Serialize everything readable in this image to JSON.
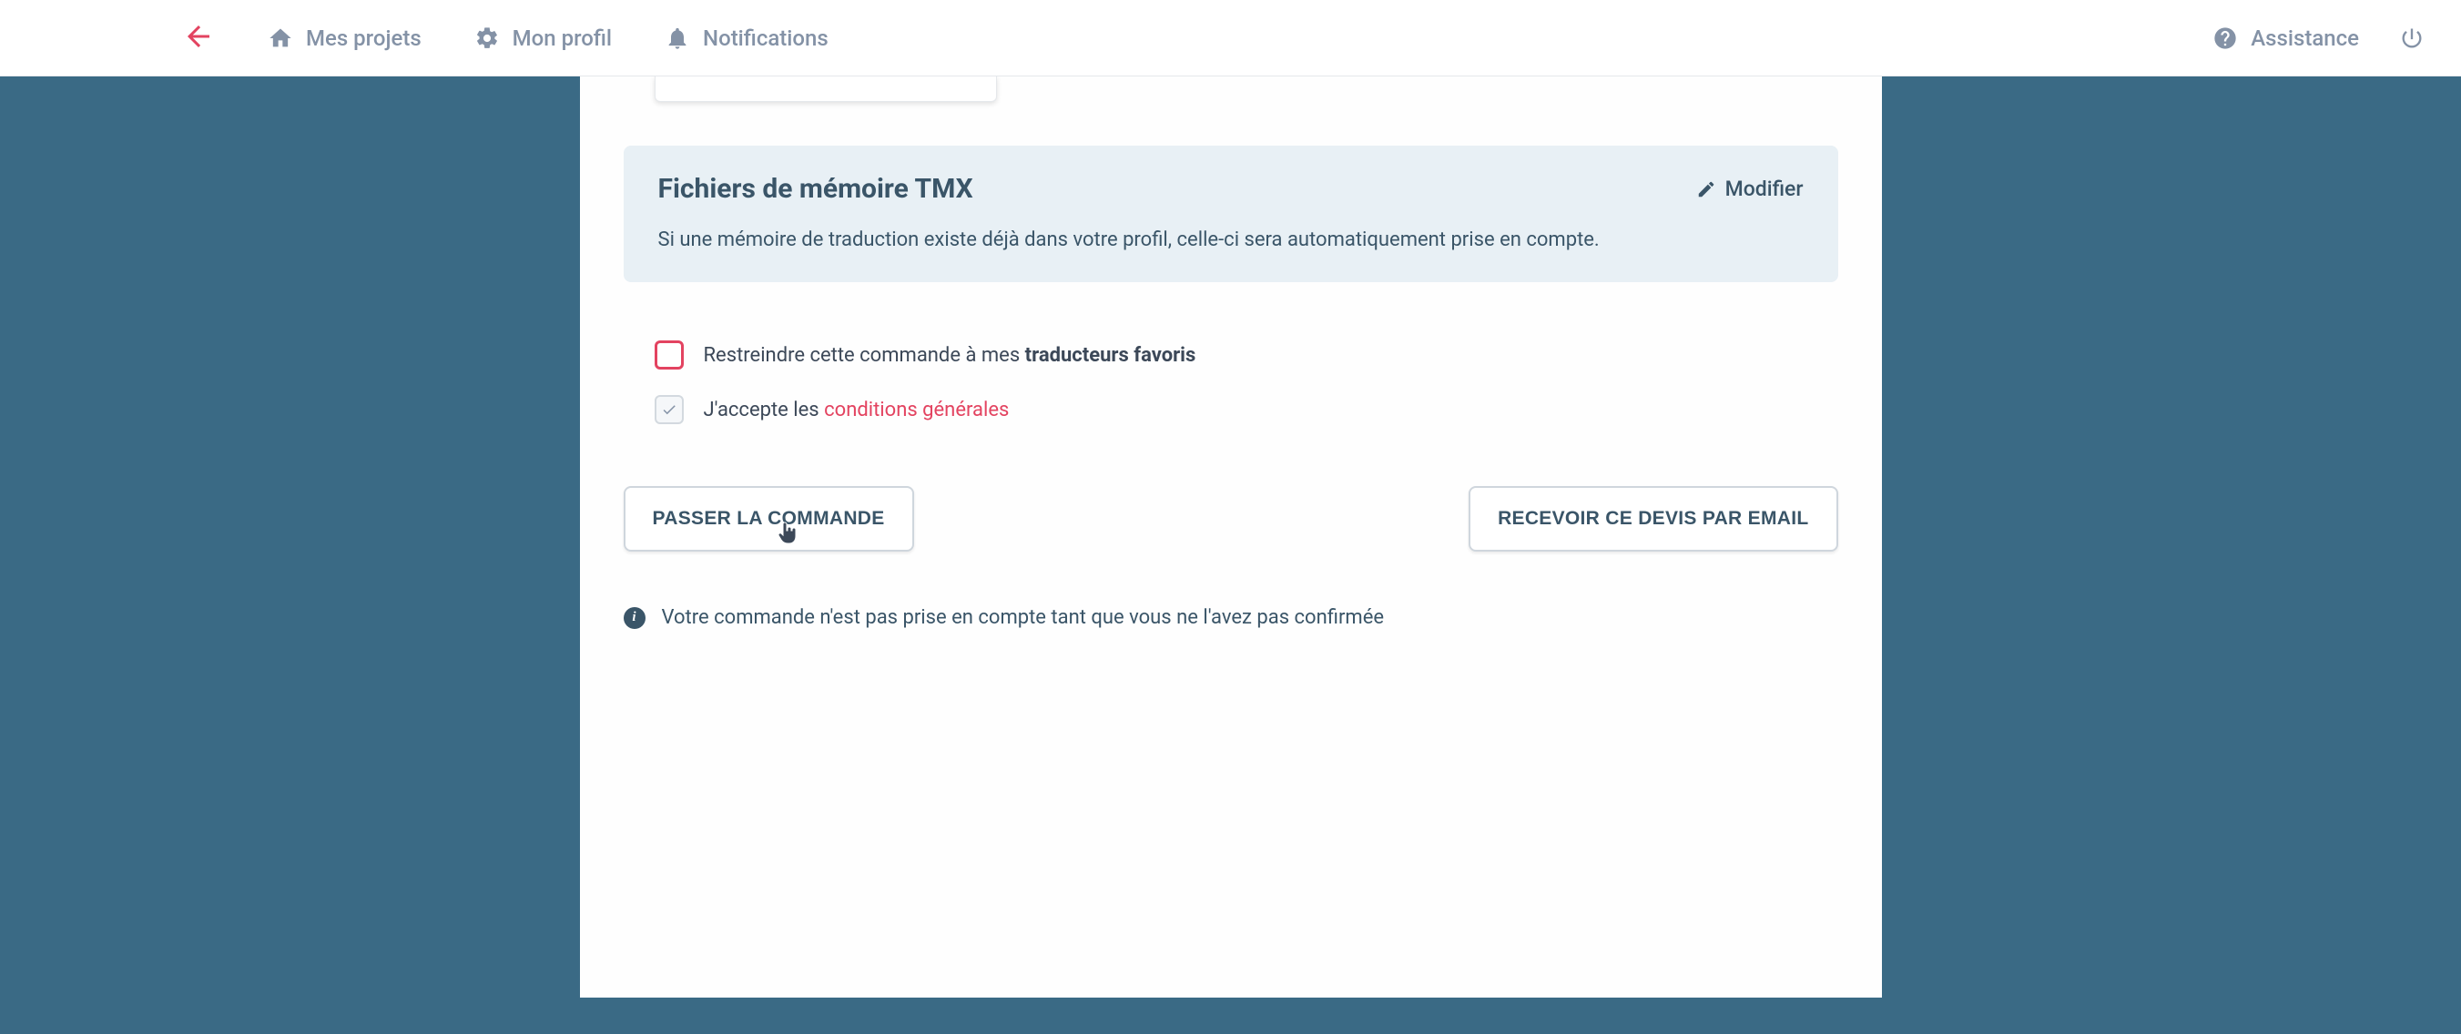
{
  "nav": {
    "projects": "Mes projets",
    "profile": "Mon profil",
    "notifications": "Notifications",
    "support": "Assistance"
  },
  "tmx": {
    "title": "Fichiers de mémoire TMX",
    "modify": "Modifier",
    "description": "Si une mémoire de traduction existe déjà dans votre profil, celle-ci sera automatiquement prise en compte."
  },
  "options": {
    "restrict_prefix": "Restreindre cette commande à mes ",
    "restrict_strong": "traducteurs favoris",
    "accept_prefix": "J'accepte les ",
    "accept_link": "conditions générales"
  },
  "actions": {
    "order": "PASSER LA COMMANDE",
    "email_quote": "RECEVOIR CE DEVIS PAR EMAIL"
  },
  "info": {
    "text": "Votre commande n'est pas prise en compte tant que vous ne l'avez pas confirmée"
  }
}
